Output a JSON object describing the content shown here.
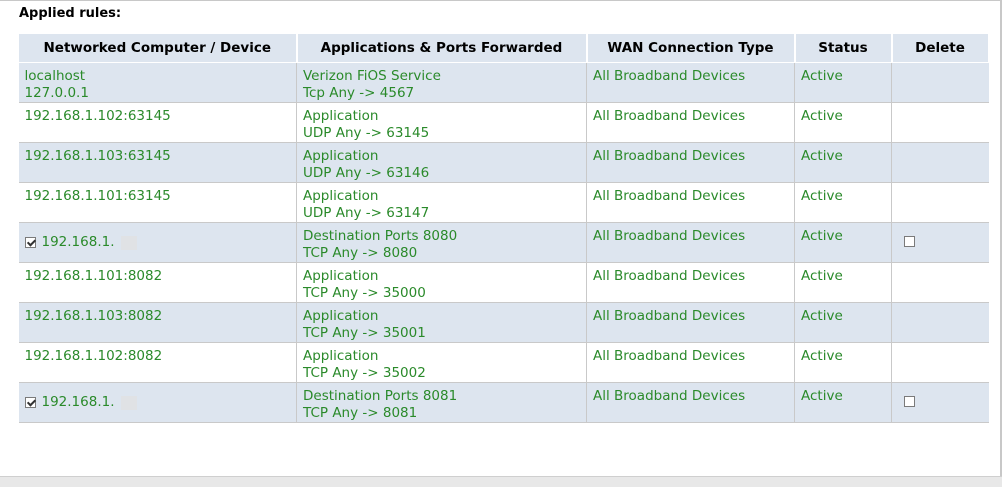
{
  "title": "Applied rules:",
  "columns": [
    "Networked Computer / Device",
    "Applications & Ports Forwarded",
    "WAN Connection Type",
    "Status",
    "Delete"
  ],
  "rows": [
    {
      "device": [
        "localhost",
        "127.0.0.1"
      ],
      "app": [
        "Verizon FiOS Service",
        "Tcp Any -> 4567"
      ],
      "wan": "All Broadband Devices",
      "status": "Active",
      "has_checkbox": false
    },
    {
      "device": [
        "192.168.1.102:63145"
      ],
      "app": [
        "Application",
        "UDP Any -> 63145"
      ],
      "wan": "All Broadband Devices",
      "status": "Active",
      "has_checkbox": false
    },
    {
      "device": [
        "192.168.1.103:63145"
      ],
      "app": [
        "Application",
        "UDP Any -> 63146"
      ],
      "wan": "All Broadband Devices",
      "status": "Active",
      "has_checkbox": false
    },
    {
      "device": [
        "192.168.1.101:63145"
      ],
      "app": [
        "Application",
        "UDP Any -> 63147"
      ],
      "wan": "All Broadband Devices",
      "status": "Active",
      "has_checkbox": false
    },
    {
      "device": [
        "192.168.1."
      ],
      "app": [
        "Destination Ports 8080",
        "TCP Any -> 8080"
      ],
      "wan": "All Broadband Devices",
      "status": "Active",
      "has_checkbox": true,
      "device_checked": true,
      "delete_checked": false
    },
    {
      "device": [
        "192.168.1.101:8082"
      ],
      "app": [
        "Application",
        "TCP Any -> 35000"
      ],
      "wan": "All Broadband Devices",
      "status": "Active",
      "has_checkbox": false
    },
    {
      "device": [
        "192.168.1.103:8082"
      ],
      "app": [
        "Application",
        "TCP Any -> 35001"
      ],
      "wan": "All Broadband Devices",
      "status": "Active",
      "has_checkbox": false
    },
    {
      "device": [
        "192.168.1.102:8082"
      ],
      "app": [
        "Application",
        "TCP Any -> 35002"
      ],
      "wan": "All Broadband Devices",
      "status": "Active",
      "has_checkbox": false
    },
    {
      "device": [
        "192.168.1."
      ],
      "app": [
        "Destination Ports 8081",
        "TCP Any -> 8081"
      ],
      "wan": "All Broadband Devices",
      "status": "Active",
      "has_checkbox": true,
      "device_checked": true,
      "delete_checked": false
    }
  ],
  "colors": {
    "text_green": "#2a8a2a",
    "row_alt": "#dde5ef",
    "header_bg": "#dde5ef"
  }
}
